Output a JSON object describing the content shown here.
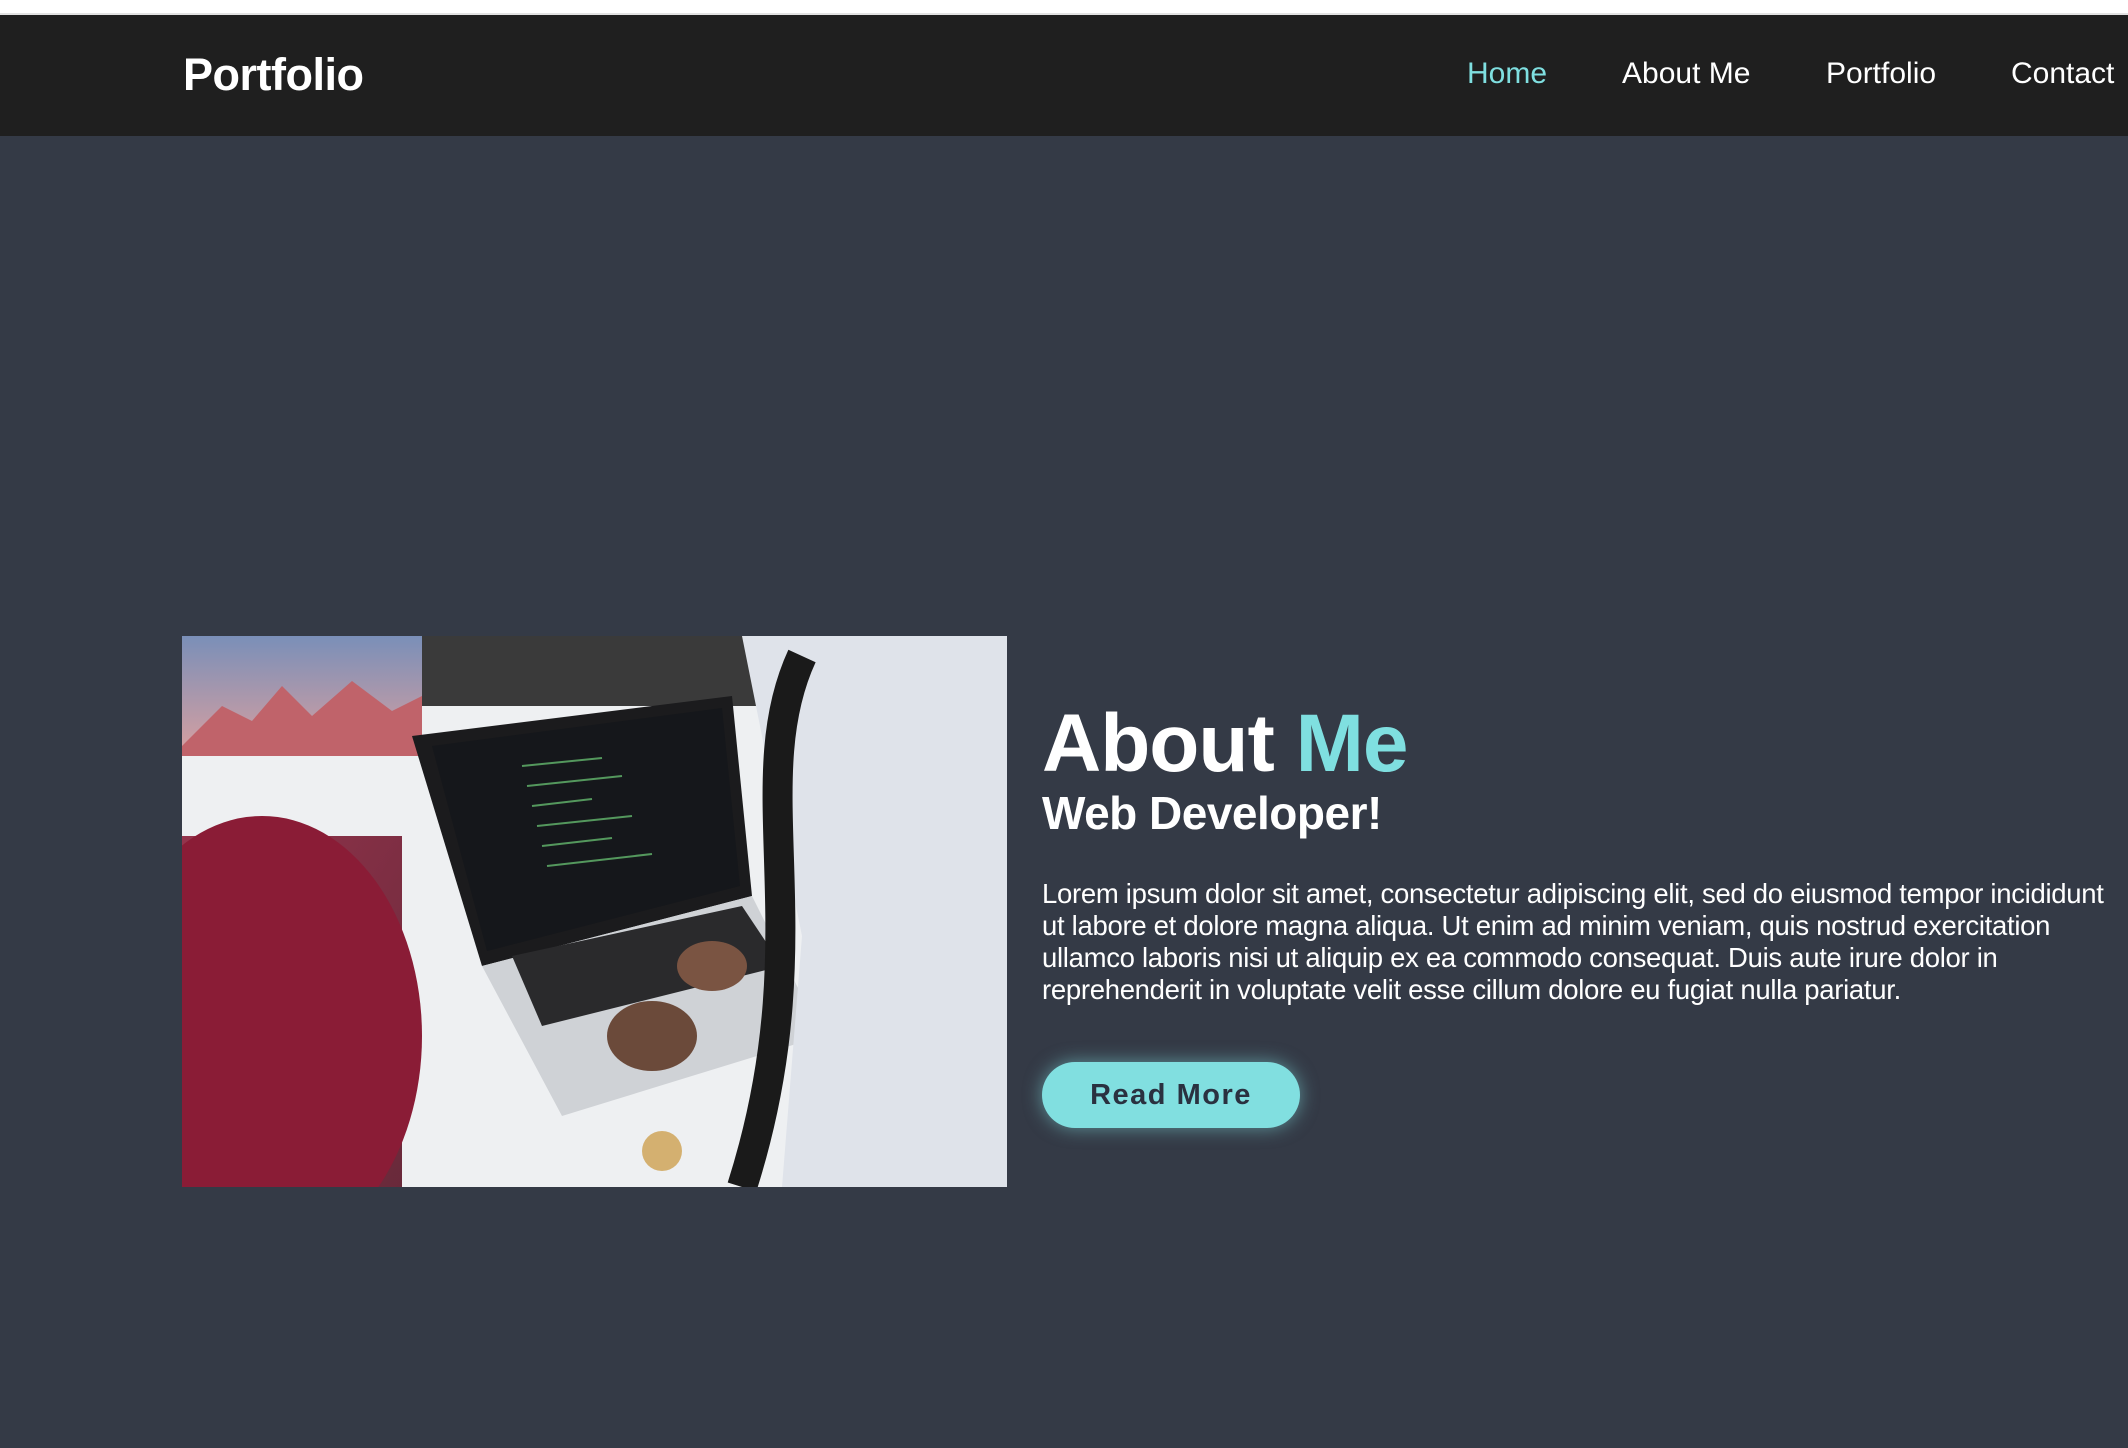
{
  "nav": {
    "logo": "Portfolio",
    "links": [
      {
        "label": "Home",
        "active": true
      },
      {
        "label": "About Me"
      },
      {
        "label": "Portfolio"
      },
      {
        "label": "Contact"
      }
    ]
  },
  "about": {
    "title_part1": "About",
    "title_part2": "Me",
    "subtitle": "Web Developer!",
    "body": "Lorem ipsum dolor sit amet, consectetur adipiscing elit, sed do eiusmod tempor incididunt ut labore et dolore magna aliqua. Ut enim ad minim veniam, quis nostrud exercitation ullamco laboris nisi ut aliquip ex ea commodo consequat. Duis aute irure dolor in reprehenderit in voluptate velit esse cillum dolore eu fugiat nulla pariatur.",
    "button_label": "Read More"
  },
  "colors": {
    "accent": "#7fdfe0",
    "navbar": "#1f1f1f",
    "background": "#343a46"
  }
}
